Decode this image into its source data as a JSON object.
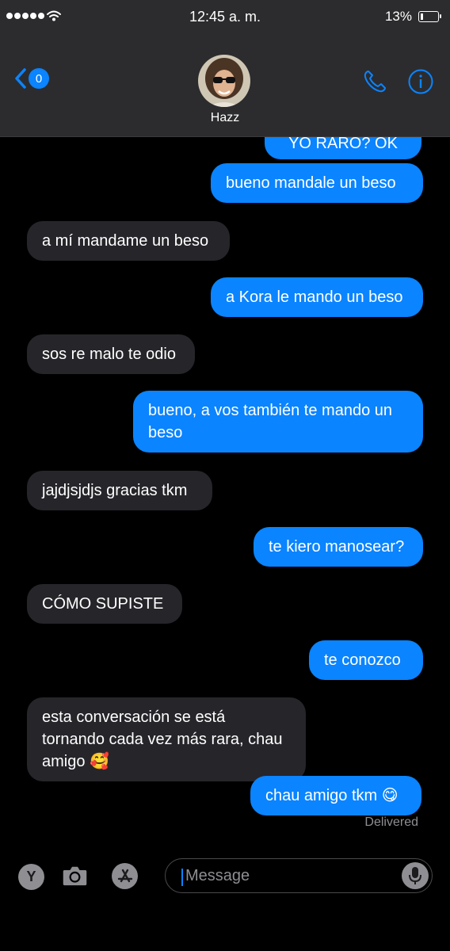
{
  "status_bar": {
    "time": "12:45 a. m.",
    "battery": "13%"
  },
  "header": {
    "back_count": "0",
    "contact_name": "Hazz"
  },
  "messages": [
    {
      "text": "YO RARO? OK",
      "sender": "me"
    },
    {
      "text": "bueno mandale un beso",
      "sender": "me"
    },
    {
      "text": "a mí mandame un beso",
      "sender": "them"
    },
    {
      "text": "a Kora le mando un beso",
      "sender": "me"
    },
    {
      "text": "sos re malo te odio",
      "sender": "them"
    },
    {
      "text": "bueno, a vos también te mando un beso",
      "sender": "me"
    },
    {
      "text": "jajdjsjdjs gracias tkm",
      "sender": "them"
    },
    {
      "text": "te kiero manosear?",
      "sender": "me"
    },
    {
      "text": "CÓMO SUPISTE",
      "sender": "them"
    },
    {
      "text": "te conozco",
      "sender": "me"
    },
    {
      "text": "esta conversación se está tornando cada vez más rara, chau amigo 🥰",
      "sender": "them"
    },
    {
      "text": "chau amigo tkm 😋",
      "sender": "me"
    }
  ],
  "delivered_label": "Delivered",
  "input": {
    "y_button": "Y",
    "placeholder": "Message"
  },
  "colors": {
    "sent_bubble": "#0a84ff",
    "received_bubble": "#26252a",
    "accent": "#0a84ff"
  }
}
